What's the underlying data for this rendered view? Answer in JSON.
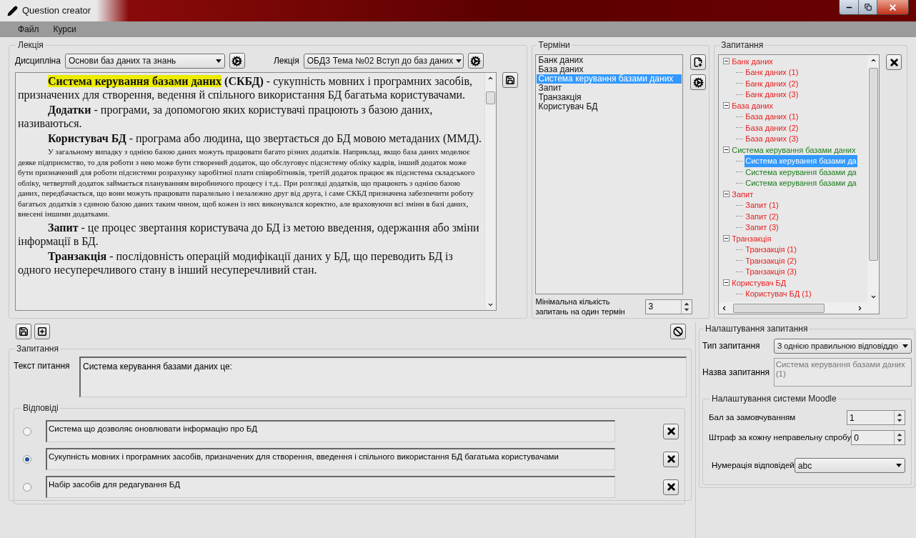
{
  "window": {
    "title": "Question creator"
  },
  "menu": [
    {
      "label": "Файл"
    },
    {
      "label": "Курси"
    }
  ],
  "lecture": {
    "title": "Лекція",
    "discipline_label": "Дисципліна",
    "discipline_value": "Основи баз даних та знань",
    "lecture_label": "Лекція",
    "lecture_value": "ОБДЗ Тема №02 Вступ до баз даних",
    "paragraphs": [
      {
        "kind": "definition",
        "term": "Система керування базами даних",
        "highlighted": true,
        "text": "**(СКБД)** - сукупність мовних і програмних засобів, призначених для створення, ведення й спільного використання БД багатьма користувачами."
      },
      {
        "kind": "definition",
        "term": "Додатки",
        "highlighted": false,
        "text": "- програми, за допомогою яких користувачі працюють з базою даних, називаються."
      },
      {
        "kind": "definition",
        "term": "Користувач БД",
        "highlighted": false,
        "text": "- програма або людина, що звертається до БД мовою метаданих (ММД)."
      },
      {
        "kind": "note",
        "text": "У загальному випадку з однією базою даних можуть працювати багато різних додатків. Наприклад, якщо база даних моделює деяке підприємство, то для роботи з нею може бути створений додаток, що обслуговує підсистему обліку кадрів, інший додаток може бути призначений для роботи підсистеми розрахунку заробітної плати співробітників, третій додаток працює як підсистема складського обліку, четвертий додаток займається плануванням виробничого процесу і т.д.. При розгляді додатків, що працюють з однією базою даних, передбачається, що вони можуть працювати паралельно і незалежно друг від друга, і саме СКБД призначена забезпечити роботу багатьох додатків з єдиною базою даних таким чином, щоб кожен із них виконувался коректно, але враховуючи всі зміни в базі даних, внесені іншими додатками."
      },
      {
        "kind": "definition",
        "term": "Запит",
        "highlighted": false,
        "text": "- це процес звертання користувача до БД із метою введення, одержання або зміни інформації в БД."
      },
      {
        "kind": "definition",
        "term": "Транзакція",
        "highlighted": false,
        "text": "- послідовність операцій модифікації даних у БД, що переводить БД із одного несуперечливого стану в інший несуперечливий стан."
      }
    ]
  },
  "terms": {
    "title": "Терміни",
    "items": [
      {
        "label": "Банк даних",
        "selected": false
      },
      {
        "label": "База даних",
        "selected": false
      },
      {
        "label": "Система керування базами даних",
        "selected": true
      },
      {
        "label": "Запит",
        "selected": false
      },
      {
        "label": "Транзакція",
        "selected": false
      },
      {
        "label": "Користувач БД",
        "selected": false
      }
    ],
    "min_label": "Мінімальна кількість запитань на один термін",
    "min_value": "3"
  },
  "questions": {
    "title": "Запитання",
    "nodes": [
      {
        "label": "Банк даних",
        "color": "#e81c1c",
        "expanded": true,
        "children": [
          {
            "label": "Банк даних (1)",
            "selected": false
          },
          {
            "label": "Банк даних (2)",
            "selected": false
          },
          {
            "label": "Банк даних (3)",
            "selected": false
          }
        ]
      },
      {
        "label": "База даних",
        "color": "#e81c1c",
        "expanded": true,
        "children": [
          {
            "label": "База даних  (1)",
            "selected": false
          },
          {
            "label": "База даних  (2)",
            "selected": false
          },
          {
            "label": "База даних  (3)",
            "selected": false
          }
        ]
      },
      {
        "label": "Система керування базами даних",
        "color": "#1a7a1a",
        "expanded": true,
        "children": [
          {
            "label": "Система керування базами да",
            "selected": true
          },
          {
            "label": "Система керування базами да",
            "selected": false
          },
          {
            "label": "Система керування базами да",
            "selected": false
          }
        ]
      },
      {
        "label": "Запит",
        "color": "#e81c1c",
        "expanded": true,
        "children": [
          {
            "label": "Запит  (1)",
            "selected": false
          },
          {
            "label": "Запит  (2)",
            "selected": false
          },
          {
            "label": "Запит  (3)",
            "selected": false
          }
        ]
      },
      {
        "label": "Транзакція",
        "color": "#e81c1c",
        "expanded": true,
        "children": [
          {
            "label": "Транзакція  (1)",
            "selected": false
          },
          {
            "label": "Транзакція  (2)",
            "selected": false
          },
          {
            "label": "Транзакція  (3)",
            "selected": false
          }
        ]
      },
      {
        "label": "Користувач БД",
        "color": "#e81c1c",
        "expanded": true,
        "children": [
          {
            "label": "Користувач БД (1)",
            "selected": false
          }
        ]
      }
    ]
  },
  "question": {
    "title": "Запитання",
    "text_label": "Текст питання",
    "text_value": "Система керування базами даних це:",
    "answers_title": "Відповіді",
    "answers": [
      {
        "text": "Система що дозволяє оновлювати інформацію про БД",
        "selected": false
      },
      {
        "text": "Сукупність мовних і програмних засобів, призначених для створення, введення і спільного використання БД багатьма користувачами",
        "selected": true
      },
      {
        "text": "Набір засобів для редагування БД",
        "selected": false
      }
    ]
  },
  "settings": {
    "title": "Налаштування запитання",
    "type_label": "Тип запитання",
    "type_value": "З однією правильною відповіддю",
    "name_label": "Назва запитання",
    "name_value": "Система керування базами даних (1)",
    "moodle": {
      "title": "Налаштування системи Moodle",
      "fields": [
        {
          "kind": "spin",
          "label": "Бал за замовчуванням",
          "value": "1"
        },
        {
          "kind": "spin",
          "label": "Штраф за кожну неправельну спробу",
          "value": "0"
        },
        {
          "kind": "select",
          "label": "Нумерація відповідей",
          "value": "abc"
        }
      ]
    }
  }
}
